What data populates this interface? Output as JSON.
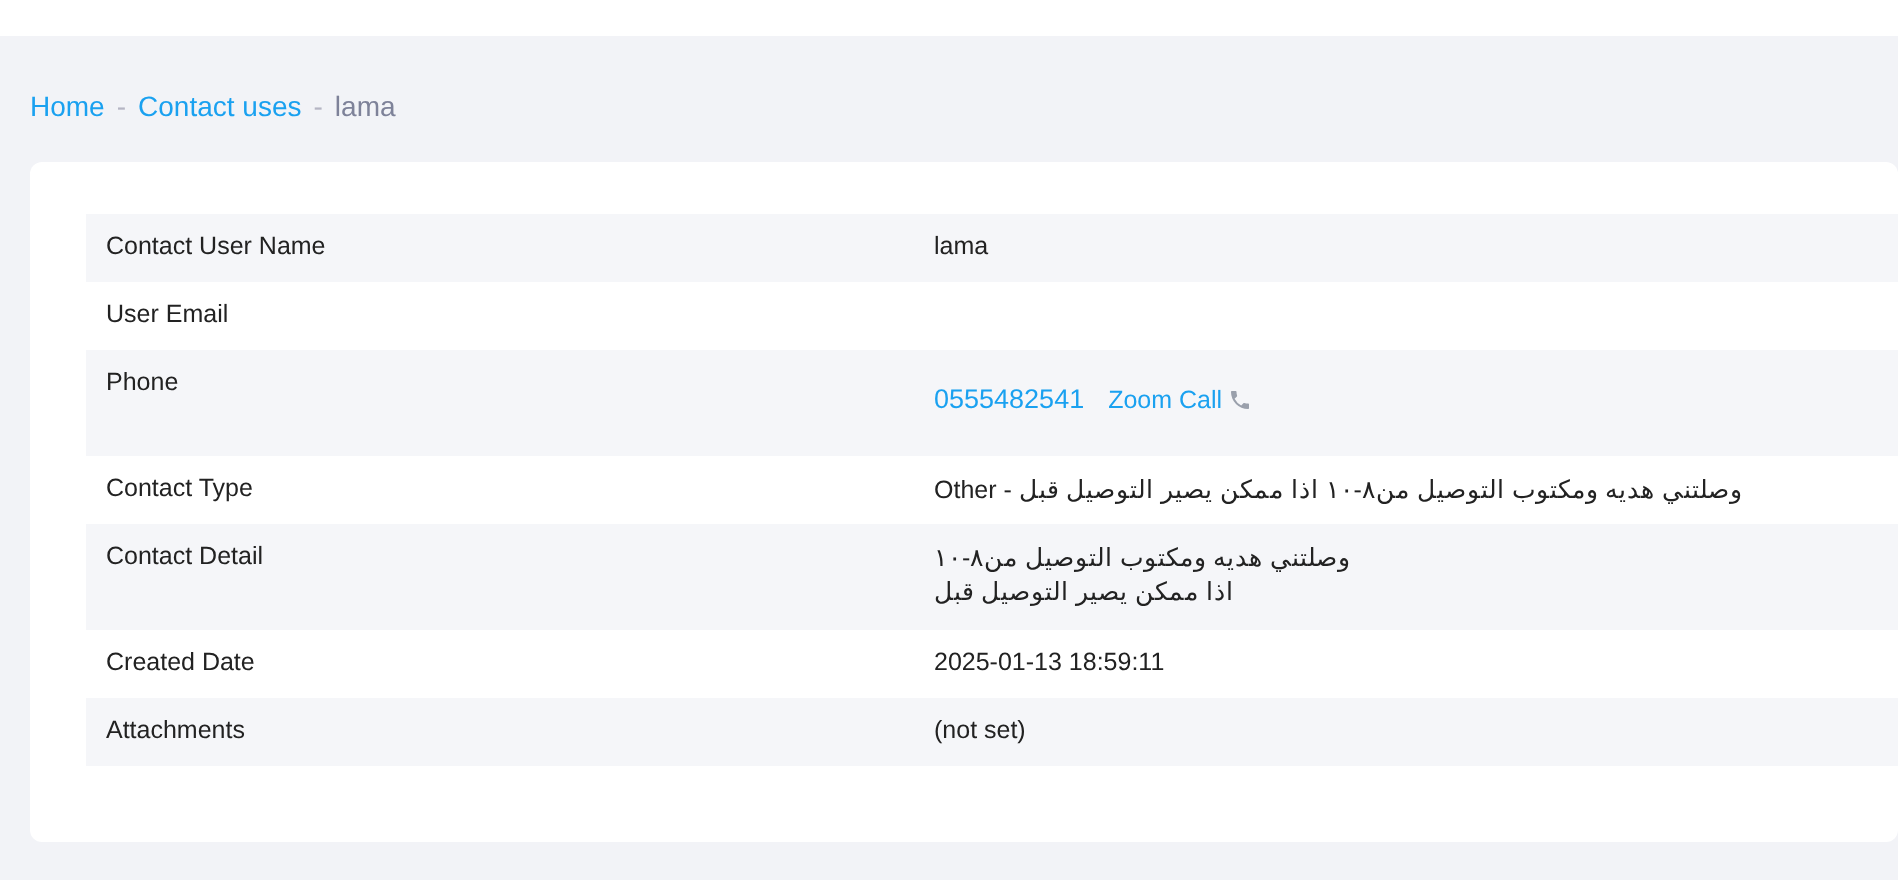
{
  "breadcrumb_separator": "-",
  "breadcrumb": [
    {
      "label": "Home",
      "kind": "link"
    },
    {
      "label": "Contact uses",
      "kind": "link"
    },
    {
      "label": "lama",
      "kind": "current"
    }
  ],
  "rows": [
    {
      "label": "Contact User Name",
      "kind": "text",
      "value": "lama"
    },
    {
      "label": "User Email",
      "kind": "text"
    },
    {
      "label": "Phone",
      "kind": "phone",
      "value": "0555482541",
      "action": "Zoom Call"
    },
    {
      "label": "Contact Type",
      "kind": "text",
      "value": "Other - وصلتني هديه ومكتوب التوصيل من٨-١٠ اذا ممكن يصير التوصيل قبل"
    },
    {
      "label": "Contact Detail",
      "kind": "lines",
      "lines": [
        "وصلتني هديه ومكتوب التوصيل من٨-١٠",
        "اذا ممكن يصير التوصيل قبل"
      ]
    },
    {
      "label": "Created Date",
      "kind": "text",
      "value": "2025-01-13 18:59:11"
    },
    {
      "label": "Attachments",
      "kind": "text",
      "value": "(not set)"
    }
  ]
}
